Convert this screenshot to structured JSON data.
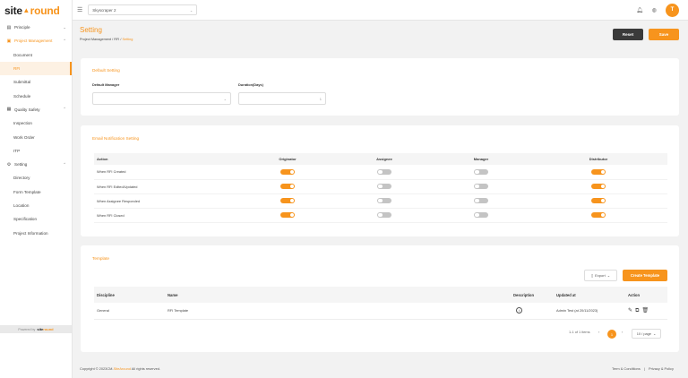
{
  "brand": {
    "part1": "site",
    "part2": "round",
    "arrow": "▲"
  },
  "topbar": {
    "project": "Skyscraper 2",
    "avatar": "T"
  },
  "sidebar": {
    "principle": "Principle",
    "project_management": "Project Management",
    "pm_items": [
      "Document",
      "RFI",
      "Submittal",
      "Schedule"
    ],
    "quality_safety": "Quality Safety",
    "qs_items": [
      "Inspection",
      "Work Order",
      "ITP"
    ],
    "setting": "Setting",
    "setting_items": [
      "Directory",
      "Form Template",
      "Location",
      "Specification",
      "Project Information"
    ],
    "powered_by": "Powered by",
    "powered_brand1": "site",
    "powered_brand2": "round"
  },
  "header": {
    "title": "Setting",
    "bc_1": "Project Management",
    "bc_sep": " / ",
    "bc_2": "RFI",
    "bc_cur": "Setting",
    "reset": "Reset",
    "save": "Save"
  },
  "default_setting": {
    "title": "Default Setting",
    "manager_label": "Default Manager",
    "duration_label": "Duration(Days)",
    "duration_value": "1"
  },
  "notification": {
    "title": "Email Notification Setting",
    "columns": [
      "Action",
      "Originator",
      "Assignee",
      "Manager",
      "Distributor"
    ],
    "rows": [
      {
        "action": "When RFI Created",
        "toggles": [
          true,
          false,
          false,
          true
        ]
      },
      {
        "action": "When RFI Edited/Updated",
        "toggles": [
          true,
          false,
          false,
          true
        ]
      },
      {
        "action": "When Assignee Responded",
        "toggles": [
          true,
          false,
          false,
          true
        ]
      },
      {
        "action": "When RFI Closed",
        "toggles": [
          true,
          false,
          false,
          true
        ]
      }
    ]
  },
  "template": {
    "title": "Template",
    "export": "Export",
    "create": "Create Template",
    "columns": [
      "Discipline",
      "Name",
      "Description",
      "Updated at",
      "Action"
    ],
    "row": {
      "discipline": "General",
      "name": "RFI Template",
      "updated": "Admin Test (at 20/11/2023)"
    },
    "pager_info": "1-1 of 1 items",
    "page": "1",
    "page_size": "10 / page"
  },
  "footer": {
    "copy_pre": "Copyright © 2023CM-",
    "copy_brand": "SiteAround",
    "copy_post": " All rights reserved.",
    "terms": "Term & Conditions",
    "sep": "|",
    "privacy": "Privacy & Policy"
  }
}
